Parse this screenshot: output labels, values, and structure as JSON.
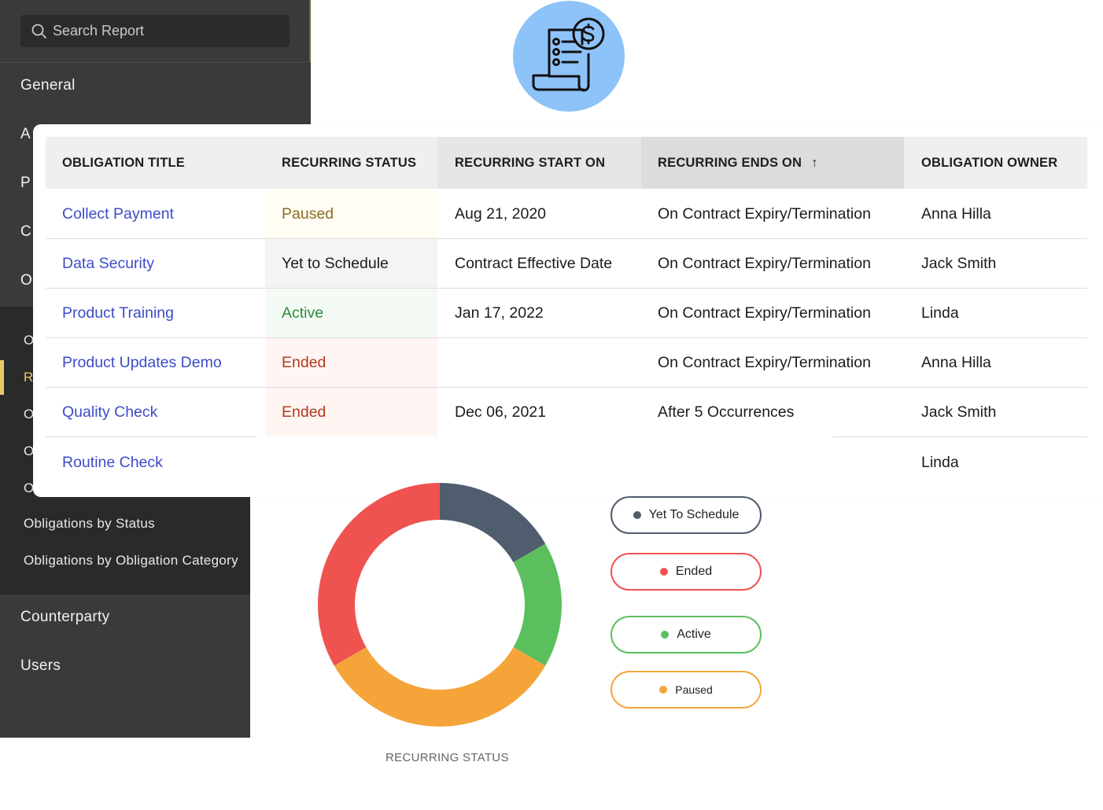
{
  "sidebar": {
    "search_placeholder": "Search Report",
    "items": [
      {
        "label": "General"
      },
      {
        "label": "A"
      },
      {
        "label": "P"
      },
      {
        "label": "C"
      },
      {
        "label": "O"
      }
    ],
    "subitems_partial": [
      "O",
      "R",
      "O",
      "O",
      "O"
    ],
    "subitems": [
      {
        "label": "Obligations by Status"
      },
      {
        "label": "Obligations by Obligation Category"
      }
    ],
    "bottom_items": [
      {
        "label": "Counterparty"
      },
      {
        "label": "Users"
      }
    ]
  },
  "table": {
    "columns": [
      "OBLIGATION TITLE",
      "RECURRING STATUS",
      "RECURRING START ON",
      "RECURRING ENDS ON",
      "OBLIGATION OWNER"
    ],
    "sort_indicator": "↑",
    "rows": [
      {
        "title": "Collect Payment",
        "status": "Paused",
        "start": "Aug 21, 2020",
        "ends": "On Contract Expiry/Termination",
        "owner": "Anna Hilla"
      },
      {
        "title": "Data Security",
        "status": "Yet to Schedule",
        "start": "Contract Effective Date",
        "ends": "On Contract Expiry/Termination",
        "owner": "Jack Smith"
      },
      {
        "title": "Product Training",
        "status": "Active",
        "start": "Jan 17, 2022",
        "ends": "On Contract Expiry/Termination",
        "owner": "Linda"
      },
      {
        "title": "Product Updates Demo",
        "status": "Ended",
        "start": "",
        "ends": "On Contract Expiry/Termination",
        "owner": "Anna Hilla"
      },
      {
        "title": "Quality Check",
        "status": "Ended",
        "start": "Dec 06, 2021",
        "ends": "After 5 Occurrences",
        "owner": "Jack Smith"
      },
      {
        "title": "Routine Check",
        "status": "",
        "start": "",
        "ends": "",
        "owner": "Linda"
      }
    ]
  },
  "colors": {
    "paused": "#f5a43a",
    "ended": "#ef5350",
    "active": "#5cbf5e",
    "yet_to_schedule": "#4f5d6e",
    "link": "#3d4bc8"
  },
  "chart_data": {
    "type": "pie",
    "title": "RECURRING STATUS",
    "categories": [
      "Yet To Schedule",
      "Active",
      "Paused",
      "Ended"
    ],
    "values": [
      1,
      1,
      2,
      2
    ],
    "colors": [
      "#4f5d6e",
      "#5cbf5e",
      "#f5a43a",
      "#ef5350"
    ],
    "legend": [
      {
        "label": "Yet To Schedule",
        "color": "#4f5d6e"
      },
      {
        "label": "Ended",
        "color": "#ef5350"
      },
      {
        "label": "Active",
        "color": "#5cbf5e"
      },
      {
        "label": "Paused",
        "color": "#f5a43a"
      }
    ]
  }
}
